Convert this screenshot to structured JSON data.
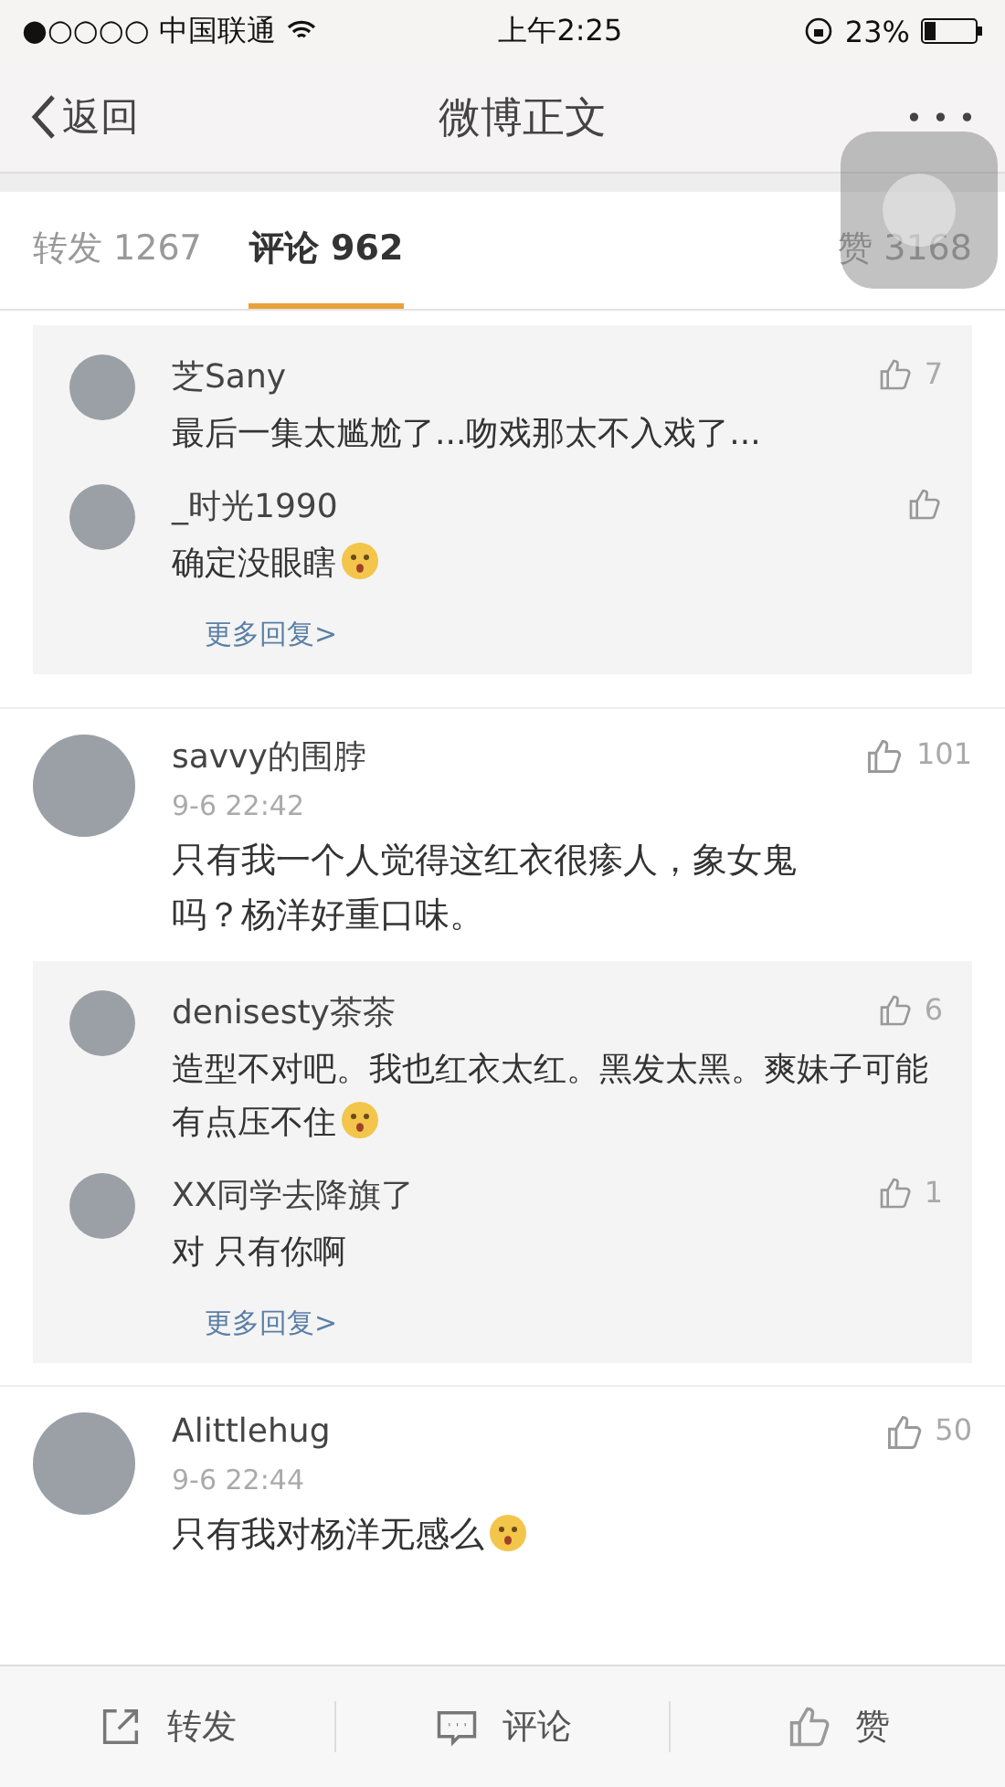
{
  "status_bar": {
    "carrier": "●○○○○ 中国联通",
    "time": "上午2:25",
    "battery": "23%"
  },
  "nav": {
    "back": "返回",
    "title": "微博正文",
    "more": "• • •"
  },
  "tabs": [
    {
      "label": "转发 1267",
      "selected": false
    },
    {
      "label": "评论 962",
      "selected": true
    },
    {
      "label": "赞 3168",
      "selected": false
    }
  ],
  "comments": [
    {
      "kind": "replies",
      "replies": [
        {
          "name": "芝Sany",
          "text": "最后一集太尴尬了...吻戏那太不入戏了...",
          "likes": "7",
          "emoji": false
        },
        {
          "name": "_时光1990",
          "text": "确定没眼瞎",
          "emoji": true
        }
      ],
      "more": "更多回复>"
    },
    {
      "kind": "comment",
      "name": "savvy的围脖",
      "time": "9-6 22:42",
      "likes": "101",
      "text": "只有我一个人觉得这红衣很瘆人，象女鬼吗？杨洋好重口味。",
      "emoji": false,
      "replies": [
        {
          "name": "denisesty茶茶",
          "text": "造型不对吧。我也红衣太红。黑发太黑。爽妹子可能有点压不住",
          "likes": "6",
          "emoji": true
        },
        {
          "name": "XX同学去降旗了",
          "text": "对 只有你啊",
          "likes": "1",
          "emoji": false
        }
      ],
      "more": "更多回复>"
    },
    {
      "kind": "comment",
      "name": "Alittlehug",
      "time": "9-6 22:44",
      "likes": "50",
      "text": "只有我对杨洋无感么",
      "emoji": true
    }
  ],
  "toolbar": [
    {
      "kind": "repost",
      "label": "转发"
    },
    {
      "kind": "comment",
      "label": "评论"
    },
    {
      "kind": "like",
      "label": "赞"
    }
  ]
}
